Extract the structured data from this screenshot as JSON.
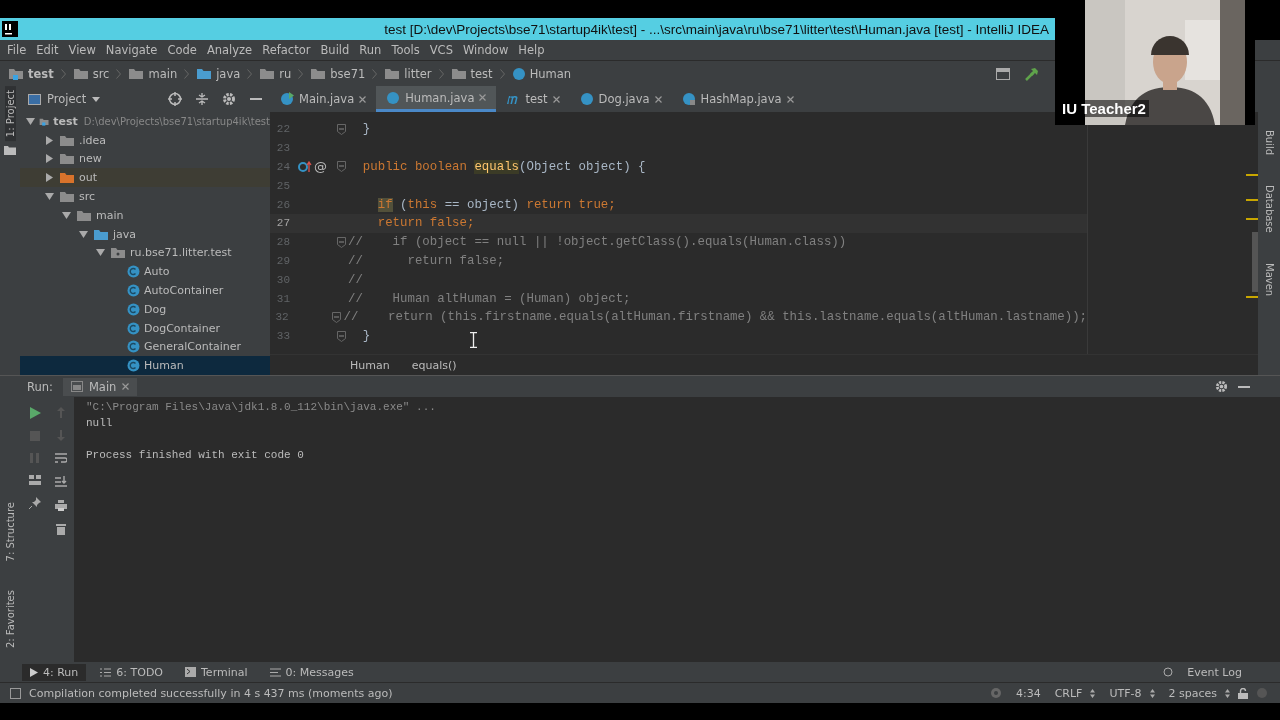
{
  "window": {
    "title": "test [D:\\dev\\Projects\\bse71\\startup4ik\\test] - ...\\src\\main\\java\\ru\\bse71\\litter\\test\\Human.java [test] - IntelliJ IDEA"
  },
  "menu": [
    "File",
    "Edit",
    "View",
    "Navigate",
    "Code",
    "Analyze",
    "Refactor",
    "Build",
    "Run",
    "Tools",
    "VCS",
    "Window",
    "Help"
  ],
  "breadcrumbs": [
    {
      "label": "test",
      "kind": "project"
    },
    {
      "label": "src",
      "kind": "folder"
    },
    {
      "label": "main",
      "kind": "folder"
    },
    {
      "label": "java",
      "kind": "source"
    },
    {
      "label": "ru",
      "kind": "package"
    },
    {
      "label": "bse71",
      "kind": "package"
    },
    {
      "label": "litter",
      "kind": "package"
    },
    {
      "label": "test",
      "kind": "package"
    },
    {
      "label": "Human",
      "kind": "class"
    }
  ],
  "left_stripe": [
    "1: Project",
    "7: Structure",
    "2: Favorites"
  ],
  "right_stripe": [
    "Build",
    "Database",
    "Maven"
  ],
  "project": {
    "title": "Project",
    "tree": [
      {
        "label": "test",
        "path": "D:\\dev\\Projects\\bse71\\startup4ik\\test",
        "kind": "project",
        "expanded": true,
        "selected": false,
        "children": [
          {
            "label": ".idea",
            "kind": "folder",
            "expanded": false,
            "selected": false
          },
          {
            "label": "new",
            "kind": "folder",
            "expanded": false,
            "selected": false
          },
          {
            "label": "out",
            "kind": "excluded",
            "expanded": false,
            "selected": false
          },
          {
            "label": "src",
            "kind": "folder",
            "expanded": true,
            "selected": false,
            "children": [
              {
                "label": "main",
                "kind": "folder",
                "expanded": true,
                "selected": false,
                "children": [
                  {
                    "label": "java",
                    "kind": "source",
                    "expanded": true,
                    "selected": false,
                    "children": [
                      {
                        "label": "ru.bse71.litter.test",
                        "kind": "package",
                        "expanded": true,
                        "selected": false,
                        "children": [
                          {
                            "label": "Auto",
                            "kind": "class",
                            "selected": false
                          },
                          {
                            "label": "AutoContainer",
                            "kind": "class",
                            "selected": false
                          },
                          {
                            "label": "Dog",
                            "kind": "class",
                            "selected": false
                          },
                          {
                            "label": "DogContainer",
                            "kind": "class",
                            "selected": false
                          },
                          {
                            "label": "GeneralContainer",
                            "kind": "class",
                            "selected": false
                          },
                          {
                            "label": "Human",
                            "kind": "class",
                            "selected": true
                          }
                        ]
                      }
                    ]
                  }
                ]
              }
            ]
          }
        ]
      }
    ]
  },
  "tabs": [
    {
      "label": "Main.java",
      "kind": "main",
      "selected": false
    },
    {
      "label": "Human.java",
      "kind": "class",
      "selected": true
    },
    {
      "label": "test",
      "kind": "module",
      "selected": false
    },
    {
      "label": "Dog.java",
      "kind": "class",
      "selected": false
    },
    {
      "label": "HashMap.java",
      "kind": "library",
      "selected": false
    }
  ],
  "code": [
    {
      "number": "22",
      "fold": true,
      "current": false,
      "segments": [
        {
          "text": "  }",
          "kind": "plain"
        }
      ]
    },
    {
      "number": "23",
      "fold": false,
      "current": false
    },
    {
      "number": "24",
      "fold": true,
      "current": false,
      "gutter_mark": "@",
      "segments": [
        {
          "text": "  public boolean ",
          "kind": "keyword"
        },
        {
          "text": "equals",
          "kind": "match"
        },
        {
          "text": "(Object object) {",
          "kind": "plain"
        }
      ]
    },
    {
      "number": "25",
      "fold": false,
      "current": false
    },
    {
      "number": "26",
      "fold": false,
      "current": false,
      "segments": [
        {
          "text": "    if",
          "kind": "keyword-match"
        },
        {
          "text": " (",
          "kind": "plain"
        },
        {
          "text": "this",
          "kind": "keyword"
        },
        {
          "text": " == object) ",
          "kind": "plain"
        },
        {
          "text": "return true;",
          "kind": "keyword"
        }
      ]
    },
    {
      "number": "27",
      "fold": false,
      "current": true,
      "segments": [
        {
          "text": "    return false;",
          "kind": "keyword"
        }
      ]
    },
    {
      "number": "28",
      "fold": true,
      "current": false,
      "segments": [
        {
          "text": "//    if (object == null || !object.getClass().equals(Human.class))",
          "kind": "comment"
        }
      ]
    },
    {
      "number": "29",
      "fold": false,
      "current": false,
      "segments": [
        {
          "text": "//      return false;",
          "kind": "comment"
        }
      ]
    },
    {
      "number": "30",
      "fold": false,
      "current": false,
      "segments": [
        {
          "text": "//",
          "kind": "comment"
        }
      ]
    },
    {
      "number": "31",
      "fold": false,
      "current": false,
      "segments": [
        {
          "text": "//    Human altHuman = (Human) object;",
          "kind": "comment"
        }
      ]
    },
    {
      "number": "32",
      "fold": true,
      "current": false,
      "segments": [
        {
          "text": "//    return (this.firstname.equals(altHuman.firstname) && this.lastname.equals(altHuman.lastname));",
          "kind": "comment"
        }
      ]
    },
    {
      "number": "33",
      "fold": true,
      "current": false,
      "segments": [
        {
          "text": "  }",
          "kind": "plain"
        }
      ]
    }
  ],
  "editor_breadcrumbs": [
    "Human",
    "equals()"
  ],
  "run": {
    "label": "Run:",
    "tab": "Main",
    "console": [
      {
        "text": "\"C:\\Program Files\\Java\\jdk1.8.0_112\\bin\\java.exe\" ...",
        "kind": "command"
      },
      {
        "text": "null",
        "kind": "output"
      },
      {
        "kind": "blank"
      },
      {
        "text": "Process finished with exit code 0",
        "kind": "output"
      }
    ]
  },
  "tool_tabs": [
    {
      "label": "4: Run",
      "kind": "run",
      "selected": true
    },
    {
      "label": "6: TODO",
      "kind": "todo",
      "selected": false
    },
    {
      "label": "Terminal",
      "kind": "terminal",
      "selected": false
    },
    {
      "label": "0: Messages",
      "kind": "messages",
      "selected": false
    }
  ],
  "event_log": "Event Log",
  "status_bar": {
    "message": "Compilation completed successfully in 4 s 437 ms (moments ago)",
    "position": "4:34",
    "line_separator": "CRLF",
    "encoding": "UTF-8",
    "indent": "2 spaces"
  },
  "webcam": {
    "kind": "picture",
    "name": "IU Teacher2"
  }
}
